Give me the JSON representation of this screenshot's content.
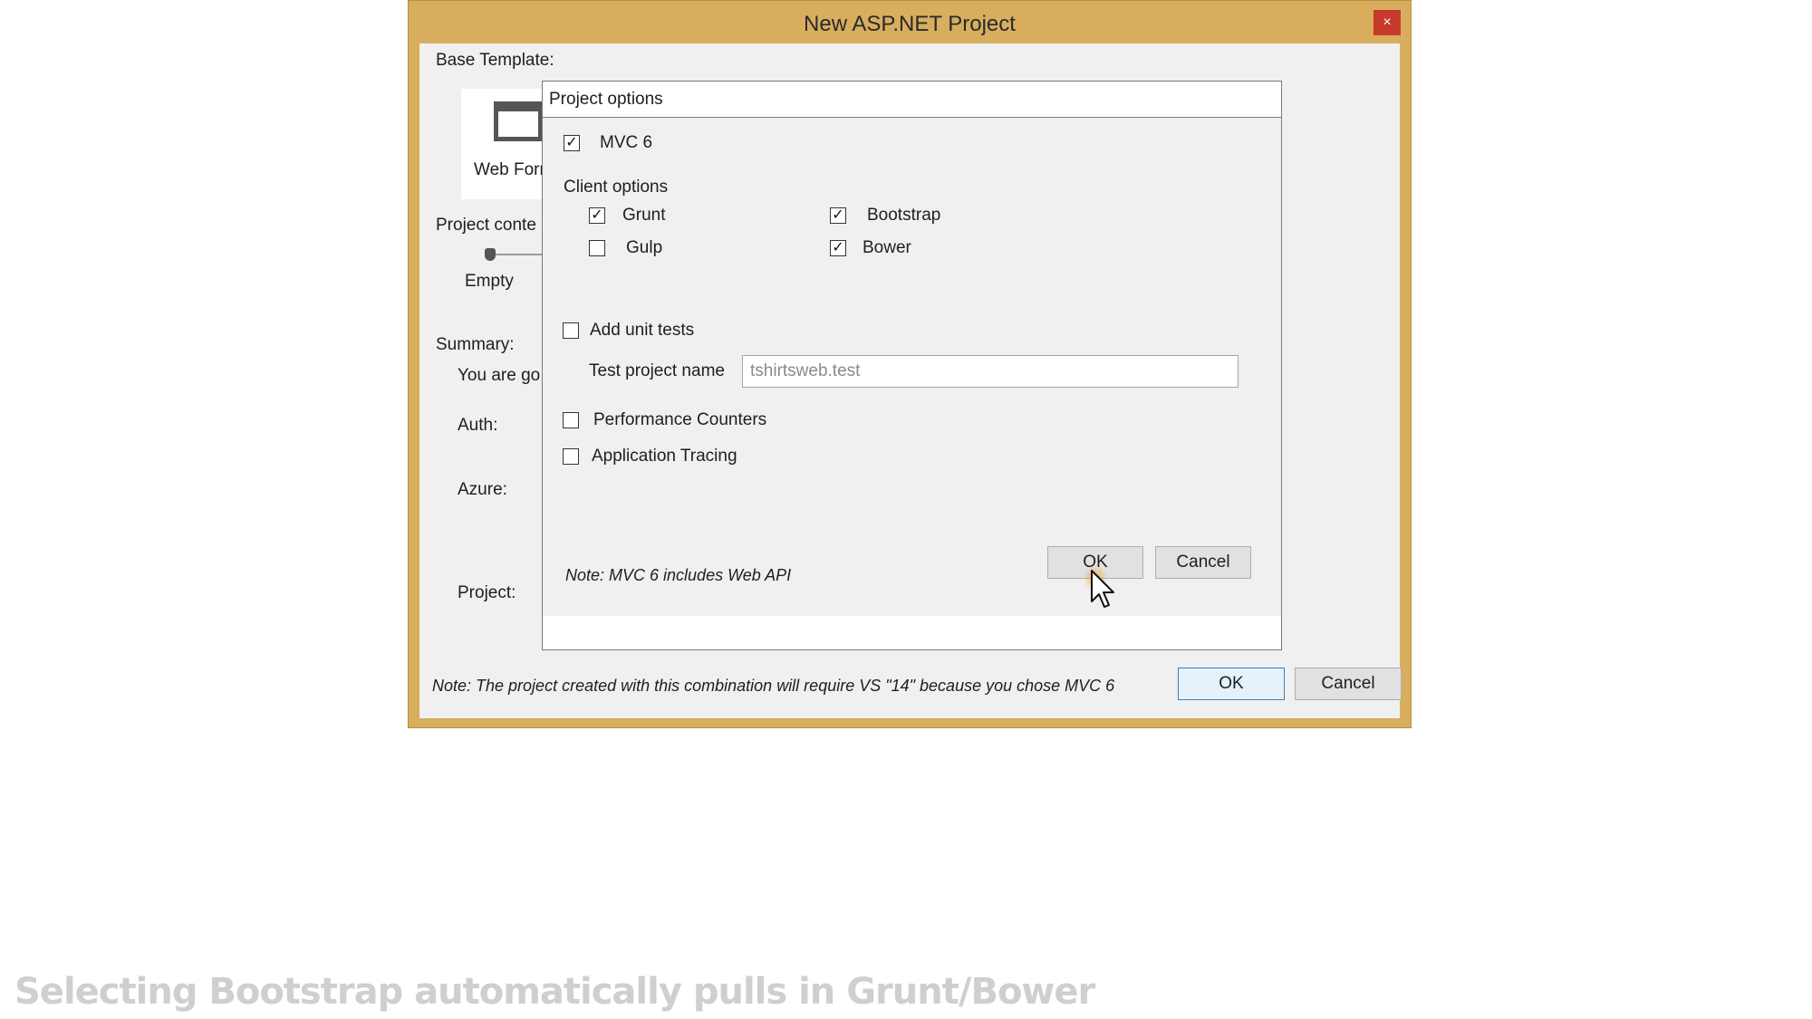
{
  "outer_dialog": {
    "title": "New ASP.NET Project",
    "close_glyph": "×",
    "base_template_label": "Base Template:",
    "template_tile_label": "Web Form",
    "project_content_label": "Project conte",
    "slider_value_label": "Empty",
    "summary_label": "Summary:",
    "summary_text": "You are go",
    "auth_label": "Auth:",
    "azure_label": "Azure:",
    "project_label": "Project:",
    "note": "Note: The project created with this combination will require VS \"14\" because you chose MVC 6",
    "ok_label": "OK",
    "cancel_label": "Cancel"
  },
  "inner_dialog": {
    "title": "Project options",
    "mvc_label": "MVC 6",
    "mvc_checked": true,
    "client_options_label": "Client options",
    "client_options": [
      {
        "label": "Grunt",
        "checked": true
      },
      {
        "label": "Gulp",
        "checked": false
      },
      {
        "label": "Bootstrap",
        "checked": true
      },
      {
        "label": "Bower",
        "checked": true
      }
    ],
    "add_unit_tests_label": "Add unit tests",
    "add_unit_tests_checked": false,
    "test_project_name_label": "Test project name",
    "test_project_name_value": "tshirtsweb.test",
    "performance_counters_label": "Performance Counters",
    "performance_counters_checked": false,
    "application_tracing_label": "Application Tracing",
    "application_tracing_checked": false,
    "note": "Note: MVC 6 includes Web API",
    "ok_label": "OK",
    "cancel_label": "Cancel",
    "check_glyph": "✓"
  },
  "caption": "Selecting Bootstrap automatically pulls in Grunt/Bower",
  "colors": {
    "window_frame": "#d8ae5e",
    "close_button": "#c7392b",
    "dialog_background": "#f0f0f0",
    "caption_text": "#cfcfcf"
  },
  "icons": [
    "close-icon",
    "window-icon",
    "mouse-pointer-icon"
  ]
}
